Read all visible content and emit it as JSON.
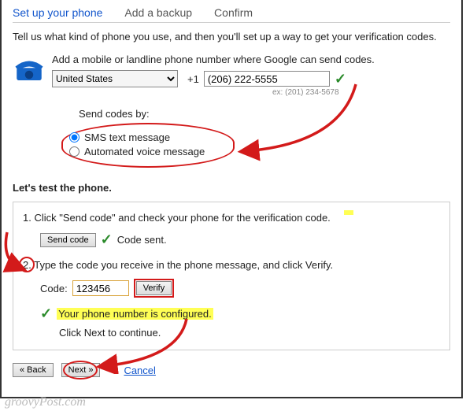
{
  "tabs": {
    "setup": "Set up your phone",
    "backup": "Add a backup",
    "confirm": "Confirm"
  },
  "intro": "Tell us what kind of phone you use, and then you'll set up a way to get your verification codes.",
  "phone": {
    "instruction": "Add a mobile or landline phone number where Google can send codes.",
    "country": "United States",
    "prefix": "+1",
    "number": "(206) 222-5555",
    "example": "ex: (201) 234-5678"
  },
  "send": {
    "label": "Send codes by:",
    "sms": "SMS text message",
    "voice": "Automated voice message"
  },
  "test": {
    "heading": "Let's test the phone.",
    "step1": "1. Click \"Send code\" and check your phone for the verification code.",
    "send_code_btn": "Send code",
    "code_sent": "Code sent.",
    "step2": "2. Type the code you receive in the phone message, and click Verify.",
    "code_label": "Code:",
    "code_value": "123456",
    "verify_btn": "Verify",
    "configured": "Your phone number is configured.",
    "next_instr": "Click Next to continue."
  },
  "nav": {
    "back": "« Back",
    "next": "Next »",
    "cancel": "Cancel"
  },
  "watermark": "groovyPost.com"
}
